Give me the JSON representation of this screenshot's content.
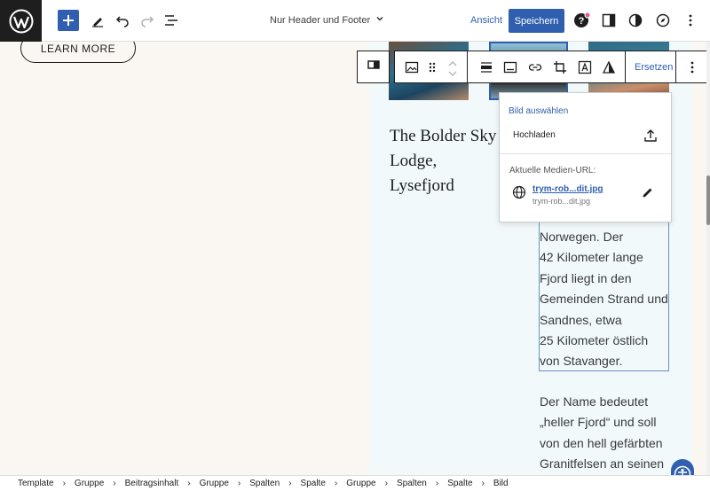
{
  "topbar": {
    "doc_title": "Nur Header und Footer",
    "view_label": "Ansicht",
    "save_label": "Speichern"
  },
  "canvas": {
    "learn_more": "LEARN MORE",
    "headline": [
      "The Bolder Sky",
      "Lodge,",
      "Lysefjord"
    ],
    "paragraph1": [
      "Norwegen. Der",
      "42 Kilometer lange",
      "Fjord liegt in den",
      "Gemeinden Strand und",
      "Sandnes, etwa",
      "25 Kilometer östlich",
      "von Stavanger."
    ],
    "paragraph2": [
      "Der Name bedeutet",
      "„heller Fjord“ und soll",
      "von den hell gefärbten",
      "Granitfelsen an seinen"
    ]
  },
  "block_toolbar": {
    "replace_label": "Ersetzen"
  },
  "replace_menu": {
    "choose_image": "Bild auswählen",
    "upload": "Hochladen",
    "current_url_title": "Aktuelle Medien-URL:",
    "file_link": "trym-rob...dit.jpg",
    "file_sub": "trym-rob...dit.jpg"
  },
  "breadcrumb": [
    "Template",
    "Gruppe",
    "Beitragsinhalt",
    "Gruppe",
    "Spalten",
    "Spalte",
    "Gruppe",
    "Spalten",
    "Spalte",
    "Bild"
  ],
  "colors": {
    "accent": "#2f5fae",
    "canvas_bg": "#faf7f2",
    "column_bg": "#f1f9fb"
  },
  "icons": [
    "wordpress-logo-icon",
    "plus-icon",
    "pen-icon",
    "undo-icon",
    "redo-icon",
    "list-view-icon",
    "chevron-down-icon",
    "help-icon",
    "sidebar-icon",
    "contrast-icon",
    "compass-icon",
    "more-vertical-icon",
    "columns-icon",
    "image-icon",
    "drag-handle-icon",
    "move-up-icon",
    "move-down-icon",
    "align-icon",
    "caption-icon",
    "link-icon",
    "crop-icon",
    "text-over-image-icon",
    "duotone-icon",
    "upload-icon",
    "globe-icon",
    "edit-pencil-icon",
    "accessibility-icon"
  ]
}
